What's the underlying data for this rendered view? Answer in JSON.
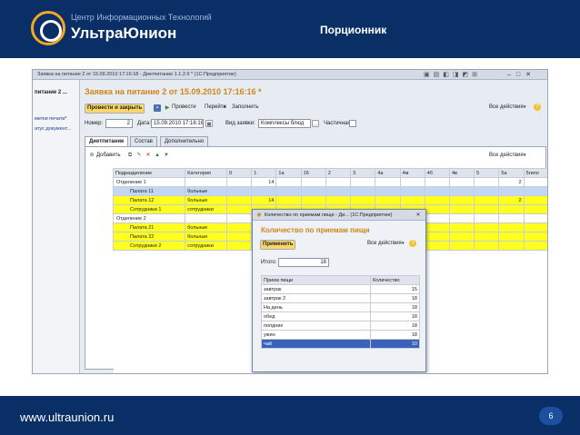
{
  "header": {
    "company_small": "Центр Информационных Технологий",
    "company_big": "УльтраЮнион",
    "slide_title": "Порционник"
  },
  "footer": {
    "url": "www.ultraunion.ru",
    "page": "6"
  },
  "app": {
    "window_title": "Заявка на питание 2 от 15.09.2010 17:16:18 - Диетпитание 1.1.2.9 * (1С:Предприятие)",
    "left_panel": [
      "питание 2 ...",
      "метки печати*",
      "атус документ..."
    ],
    "doc_title": "Заявка на питание 2 от 15.09.2010 17:16:16 *",
    "toolbar": {
      "post_close": "Провести и закрыть",
      "post": "Провести",
      "goto": "Перейти",
      "fill": "Заполнить",
      "all_actions": "Все действия"
    },
    "fields": {
      "number_label": "Номер:",
      "number": "2",
      "date_label": "Дата:",
      "date": "15.09.2010 17:16:16",
      "type_label": "Вид заявки:",
      "type": "Комплексы блюд",
      "partial": "Частичная:"
    },
    "tabs": [
      "Диетпитание",
      "Состав",
      "Дополнительно"
    ],
    "add": "Добавить",
    "columns": [
      "Подразделение",
      "Категория",
      "0",
      "1",
      "1а",
      "16",
      "2",
      "3",
      "4а",
      "4м",
      "4б",
      "4в",
      "5",
      "5а",
      "5гипо"
    ],
    "rows": [
      {
        "name": "Отделение 1",
        "cat": "",
        "v1": "14",
        "v5a": "2",
        "kind": "grp"
      },
      {
        "name": "Палата 11",
        "cat": "больные",
        "v1": "",
        "v5a": "",
        "kind": "sel"
      },
      {
        "name": "Палата 12",
        "cat": "больные",
        "v1": "14",
        "v5a": "2",
        "kind": "yel"
      },
      {
        "name": "Сотрудники 1",
        "cat": "сотрудники",
        "v1": "",
        "v5a": "",
        "kind": "yel"
      },
      {
        "name": "Отделение 2",
        "cat": "",
        "v1": "",
        "v5a": "",
        "kind": "grp"
      },
      {
        "name": "Палата 21",
        "cat": "больные",
        "v1": "",
        "v5a": "",
        "kind": "yel"
      },
      {
        "name": "Палата 22",
        "cat": "больные",
        "v1": "",
        "v5a": "",
        "kind": "yel"
      },
      {
        "name": "Сотрудники 2",
        "cat": "сотрудники",
        "v1": "",
        "v5a": "",
        "kind": "yel"
      }
    ],
    "total": {
      "label": "Всего:",
      "v1": "14",
      "v5a": "2"
    }
  },
  "dialog": {
    "title": "Количество по приемам пищи - Ди... (1С:Предприятие)",
    "header": "Количество по приемам пищи",
    "apply": "Применить",
    "all_actions": "Все действия",
    "total_label": "Итого:",
    "total": "18",
    "columns": [
      "Прием пищи",
      "Количество"
    ],
    "rows": [
      {
        "meal": "завтрак",
        "qty": "15"
      },
      {
        "meal": "завтрак 2",
        "qty": "18"
      },
      {
        "meal": "На день",
        "qty": "18"
      },
      {
        "meal": "обед",
        "qty": "18"
      },
      {
        "meal": "полдник",
        "qty": "18"
      },
      {
        "meal": "ужин",
        "qty": "18"
      },
      {
        "meal": "чай",
        "qty": "10"
      }
    ]
  }
}
